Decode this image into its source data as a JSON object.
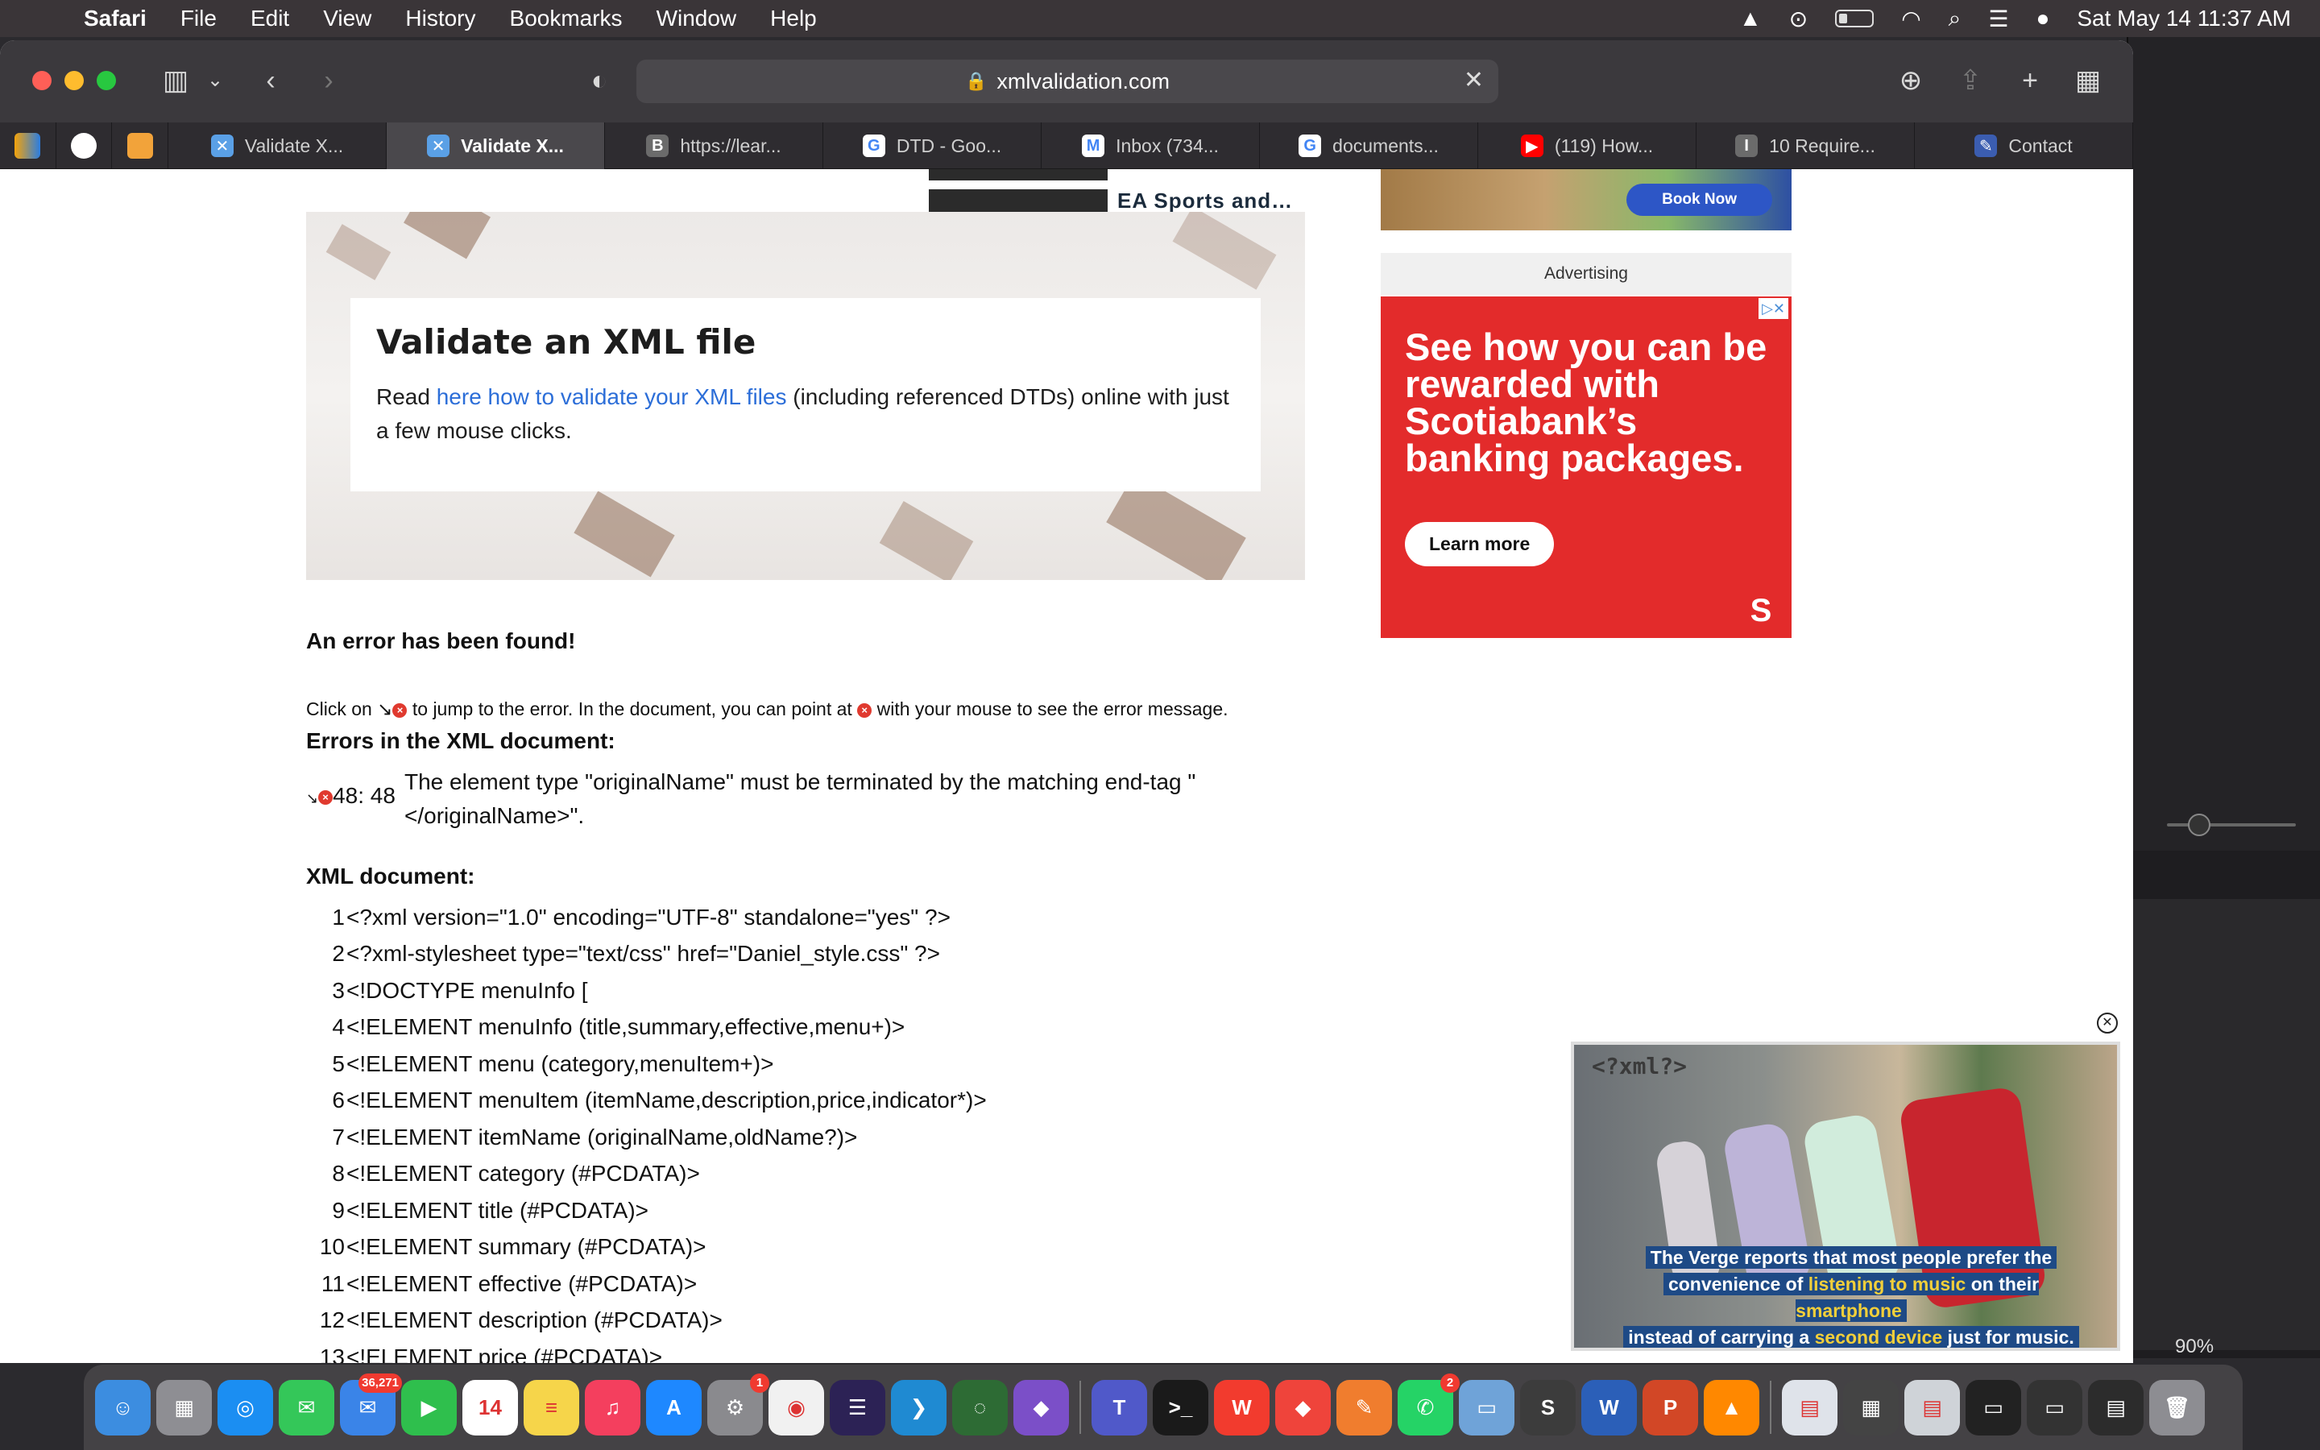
{
  "menubar": {
    "app_name": "Safari",
    "items": [
      "File",
      "Edit",
      "View",
      "History",
      "Bookmarks",
      "Window",
      "Help"
    ],
    "datetime": "Sat May 14  11:37 AM"
  },
  "browser": {
    "url": "xmlvalidation.com",
    "tabs": [
      {
        "label": "Validate X...",
        "icon": "xmlvalidation-icon",
        "color": "#5aa0e6",
        "glyph": "✕"
      },
      {
        "label": "Validate X...",
        "icon": "xmlvalidation-icon",
        "color": "#5aa0e6",
        "glyph": "✕",
        "active": true
      },
      {
        "label": "https://lear...",
        "icon": "bookmark-b-icon",
        "color": "#6b6b6b",
        "glyph": "B"
      },
      {
        "label": "DTD - Goo...",
        "icon": "google-icon",
        "color": "#ffffff",
        "glyph": "G"
      },
      {
        "label": "Inbox (734...",
        "icon": "gmail-icon",
        "color": "#ffffff",
        "glyph": "M"
      },
      {
        "label": "documents...",
        "icon": "google-icon",
        "color": "#ffffff",
        "glyph": "G"
      },
      {
        "label": "(119) How...",
        "icon": "youtube-icon",
        "color": "#ff0000",
        "glyph": "▶"
      },
      {
        "label": "10 Require...",
        "icon": "bookmark-i-icon",
        "color": "#6b6b6b",
        "glyph": "I"
      },
      {
        "label": "Contact",
        "icon": "contact-icon",
        "color": "#3b5db0",
        "glyph": "✎"
      }
    ]
  },
  "page": {
    "related_title": "EA Sports and…",
    "book_now": "Book Now",
    "hero_title": "Validate an XML file",
    "hero_text_before": "Read ",
    "hero_link": "here how to validate your XML files",
    "hero_text_after": " (including referenced DTDs) online with just a few mouse clicks.",
    "error_found": "An error has been found!",
    "hint_1": "Click on ",
    "hint_2": " to jump to the error. In the document, you can point at ",
    "hint_3": " with your mouse to see the error message.",
    "errors_heading": "Errors in the XML document:",
    "error_location": "48: 48",
    "error_message": "The element type \"originalName\" must be terminated by the matching end-tag \"</originalName>\".",
    "xml_heading": "XML document:",
    "code_lines": [
      {
        "n": "1",
        "t": "<?xml version=\"1.0\" encoding=\"UTF-8\" standalone=\"yes\" ?>"
      },
      {
        "n": "2",
        "t": "<?xml-stylesheet type=\"text/css\" href=\"Daniel_style.css\" ?>"
      },
      {
        "n": "3",
        "t": "<!DOCTYPE menuInfo ["
      },
      {
        "n": "4",
        "t": "<!ELEMENT menuInfo (title,summary,effective,menu+)>"
      },
      {
        "n": "5",
        "t": "<!ELEMENT menu (category,menuItem+)>"
      },
      {
        "n": "6",
        "t": "<!ELEMENT menuItem (itemName,description,price,indicator*)>"
      },
      {
        "n": "7",
        "t": "<!ELEMENT itemName (originalName,oldName?)>"
      },
      {
        "n": "8",
        "t": "<!ELEMENT category (#PCDATA)>"
      },
      {
        "n": "9",
        "t": "<!ELEMENT title (#PCDATA)>"
      },
      {
        "n": "10",
        "t": "<!ELEMENT summary (#PCDATA)>"
      },
      {
        "n": "11",
        "t": "<!ELEMENT effective (#PCDATA)>"
      },
      {
        "n": "12",
        "t": "<!ELEMENT description (#PCDATA)>"
      },
      {
        "n": "13",
        "t": "<!ELEMENT price (#PCDATA)>"
      }
    ],
    "advertising_label": "Advertising",
    "ad_headline": "See how you can be rewarded with Scotiabank’s banking packages.",
    "ad_button": "Learn more"
  },
  "video": {
    "code_text": "<?xml?>",
    "caption_1": "The Verge reports that most people prefer the",
    "caption_2a": "convenience of ",
    "caption_2b": "listening to music",
    "caption_2c": " on their ",
    "caption_2d": "smartphone",
    "caption_3a": "instead of carrying a ",
    "caption_3b": "second device",
    "caption_3c": " just for music."
  },
  "background_window": {
    "zoom": "90%"
  },
  "dock": {
    "apps": [
      {
        "name": "finder-icon",
        "color": "#3c8de0",
        "glyph": "☺"
      },
      {
        "name": "launchpad-icon",
        "color": "#8e8e93",
        "glyph": "▦"
      },
      {
        "name": "safari-icon",
        "color": "#1b8ef2",
        "glyph": "◎"
      },
      {
        "name": "messages-icon",
        "color": "#34c759",
        "glyph": "✉"
      },
      {
        "name": "mail-icon",
        "color": "#3a84e8",
        "glyph": "✉",
        "badge": "36,271"
      },
      {
        "name": "facetime-icon",
        "color": "#2fbf4d",
        "glyph": "▶"
      },
      {
        "name": "calendar-icon",
        "color": "#ffffff",
        "glyph": "14"
      },
      {
        "name": "notes-icon",
        "color": "#f6d54a",
        "glyph": "≡"
      },
      {
        "name": "music-icon",
        "color": "#f43f5e",
        "glyph": "♫"
      },
      {
        "name": "app-store-icon",
        "color": "#1e88ff",
        "glyph": "A"
      },
      {
        "name": "system-preferences-icon",
        "color": "#8a8a8e",
        "glyph": "⚙",
        "badge": "1"
      },
      {
        "name": "chrome-icon",
        "color": "#f1f1f1",
        "glyph": "◉"
      },
      {
        "name": "eclipse-icon",
        "color": "#2c2255",
        "glyph": "☰"
      },
      {
        "name": "vscode-icon",
        "color": "#1f8ad2",
        "glyph": "❯"
      },
      {
        "name": "activity-icon",
        "color": "#2d6b34",
        "glyph": "◌"
      },
      {
        "name": "visual-studio-icon",
        "color": "#7b4fc8",
        "glyph": "◆"
      },
      {
        "name": "teams-icon",
        "color": "#5059c9",
        "glyph": "T"
      },
      {
        "name": "terminal-icon",
        "color": "#1a1a1a",
        "glyph": ">_"
      },
      {
        "name": "wps-icon",
        "color": "#f23b2e",
        "glyph": "W"
      },
      {
        "name": "anydesk-icon",
        "color": "#ef443b",
        "glyph": "◆"
      },
      {
        "name": "pdf-expert-icon",
        "color": "#f07d2e",
        "glyph": "✎"
      },
      {
        "name": "whatsapp-icon",
        "color": "#25d366",
        "glyph": "✆",
        "badge": "2"
      },
      {
        "name": "preview-icon",
        "color": "#6fa3d8",
        "glyph": "▭"
      },
      {
        "name": "sublime-icon",
        "color": "#3c3c3c",
        "glyph": "S"
      },
      {
        "name": "word-icon",
        "color": "#2b5fb8",
        "glyph": "W"
      },
      {
        "name": "powerpoint-icon",
        "color": "#d24726",
        "glyph": "P"
      },
      {
        "name": "vlc-icon",
        "color": "#ff8800",
        "glyph": "▲"
      },
      {
        "name": "pdf-document-icon",
        "color": "#dfe3ea",
        "glyph": "▤"
      },
      {
        "name": "calendar-thumb-icon",
        "color": "#444",
        "glyph": "▦"
      },
      {
        "name": "screenshot-icon",
        "color": "#cfd3d8",
        "glyph": "▤"
      },
      {
        "name": "window-thumb-icon",
        "color": "#222",
        "glyph": "▭"
      },
      {
        "name": "window-thumb-2-icon",
        "color": "#333",
        "glyph": "▭"
      },
      {
        "name": "window-thumb-3-icon",
        "color": "#2c2c2c",
        "glyph": "▤"
      },
      {
        "name": "trash-icon",
        "color": "#8d8d92",
        "glyph": "🗑"
      }
    ]
  }
}
